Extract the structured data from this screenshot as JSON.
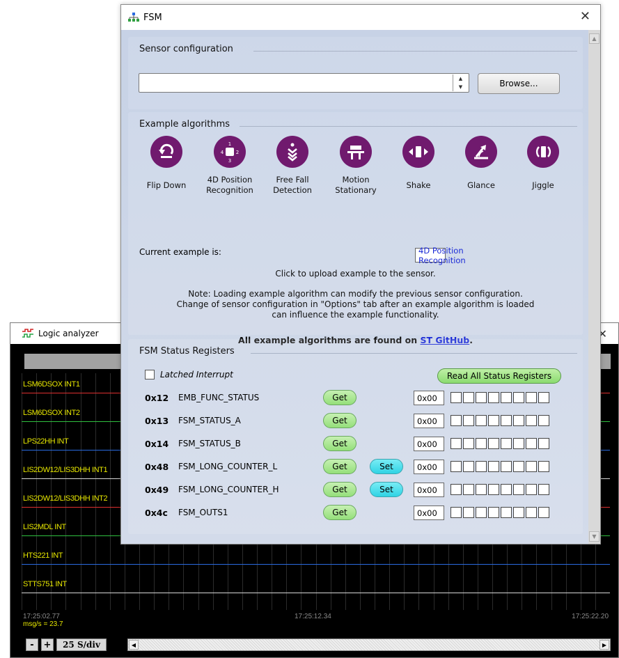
{
  "logic_analyzer": {
    "title": "Logic analyzer",
    "close_glyph": "✕",
    "channels": [
      {
        "label": "LSM6DSOX INT1",
        "color": "#e03030"
      },
      {
        "label": "LSM6DSOX INT2",
        "color": "#30c040"
      },
      {
        "label": "LPS22HH INT",
        "color": "#2a6ae0"
      },
      {
        "label": "LIS2DW12/LIS3DHH INT1",
        "color": "#d8d8d8"
      },
      {
        "label": "LIS2DW12/LIS3DHH INT2",
        "color": "#e03030"
      },
      {
        "label": "LIS2MDL INT",
        "color": "#30c040"
      },
      {
        "label": "HTS221 INT",
        "color": "#2a6ae0"
      },
      {
        "label": "STTS751 INT",
        "color": "#d8d8d8"
      }
    ],
    "time_left": "17:25:02.77",
    "time_mid": "17:25:12.34",
    "time_right": "17:25:22.20",
    "rate": "msg/s = 23.7",
    "minus": "-",
    "plus": "+",
    "divisor": "25 S/div",
    "scroll_left": "◀",
    "scroll_right": "▶"
  },
  "fsm": {
    "title": "FSM",
    "close_glyph": "✕",
    "sensor_config": {
      "title": "Sensor configuration",
      "input_value": "",
      "browse_label": "Browse..."
    },
    "examples": {
      "title": "Example algorithms",
      "items": [
        {
          "name": "Flip Down",
          "icon": "flip-down-icon"
        },
        {
          "name": "4D Position Recognition",
          "icon": "4d-position-icon"
        },
        {
          "name": "Free Fall Detection",
          "icon": "free-fall-icon"
        },
        {
          "name": "Motion Stationary",
          "icon": "motion-stationary-icon"
        },
        {
          "name": "Shake",
          "icon": "shake-icon"
        },
        {
          "name": "Glance",
          "icon": "glance-icon"
        },
        {
          "name": "Jiggle",
          "icon": "jiggle-icon"
        }
      ],
      "current_label": "Current example is:",
      "current_value": "4D Position Recognition",
      "click_note": "Click to upload example to the sensor.",
      "note_line1": "Note: Loading example algorithm can modify the previous sensor configuration.",
      "note_line2": "Change of sensor configuration in \"Options\" tab after an example algorithm is loaded",
      "note_line3": "can influence the example functionality.",
      "github_text": "All example algorithms are found on ",
      "github_link": "ST GitHub",
      "github_suffix": "."
    },
    "status": {
      "title": "FSM Status Registers",
      "latched_label": "Latched Interrupt",
      "read_all_label": "Read All Status Registers",
      "get_label": "Get",
      "set_label": "Set",
      "registers": [
        {
          "addr": "0x12",
          "name": "EMB_FUNC_STATUS",
          "value": "0x00",
          "has_set": false
        },
        {
          "addr": "0x13",
          "name": "FSM_STATUS_A",
          "value": "0x00",
          "has_set": false
        },
        {
          "addr": "0x14",
          "name": "FSM_STATUS_B",
          "value": "0x00",
          "has_set": false
        },
        {
          "addr": "0x48",
          "name": "FSM_LONG_COUNTER_L",
          "value": "0x00",
          "has_set": true
        },
        {
          "addr": "0x49",
          "name": "FSM_LONG_COUNTER_H",
          "value": "0x00",
          "has_set": true
        },
        {
          "addr": "0x4c",
          "name": "FSM_OUTS1",
          "value": "0x00",
          "has_set": false
        }
      ]
    }
  },
  "colors": {
    "icon_purple": "#701a6e",
    "get_green": "#94df7a",
    "set_cyan": "#2fd3e4",
    "link_blue": "#1a2ad6",
    "channel_label": "#e8e800"
  }
}
